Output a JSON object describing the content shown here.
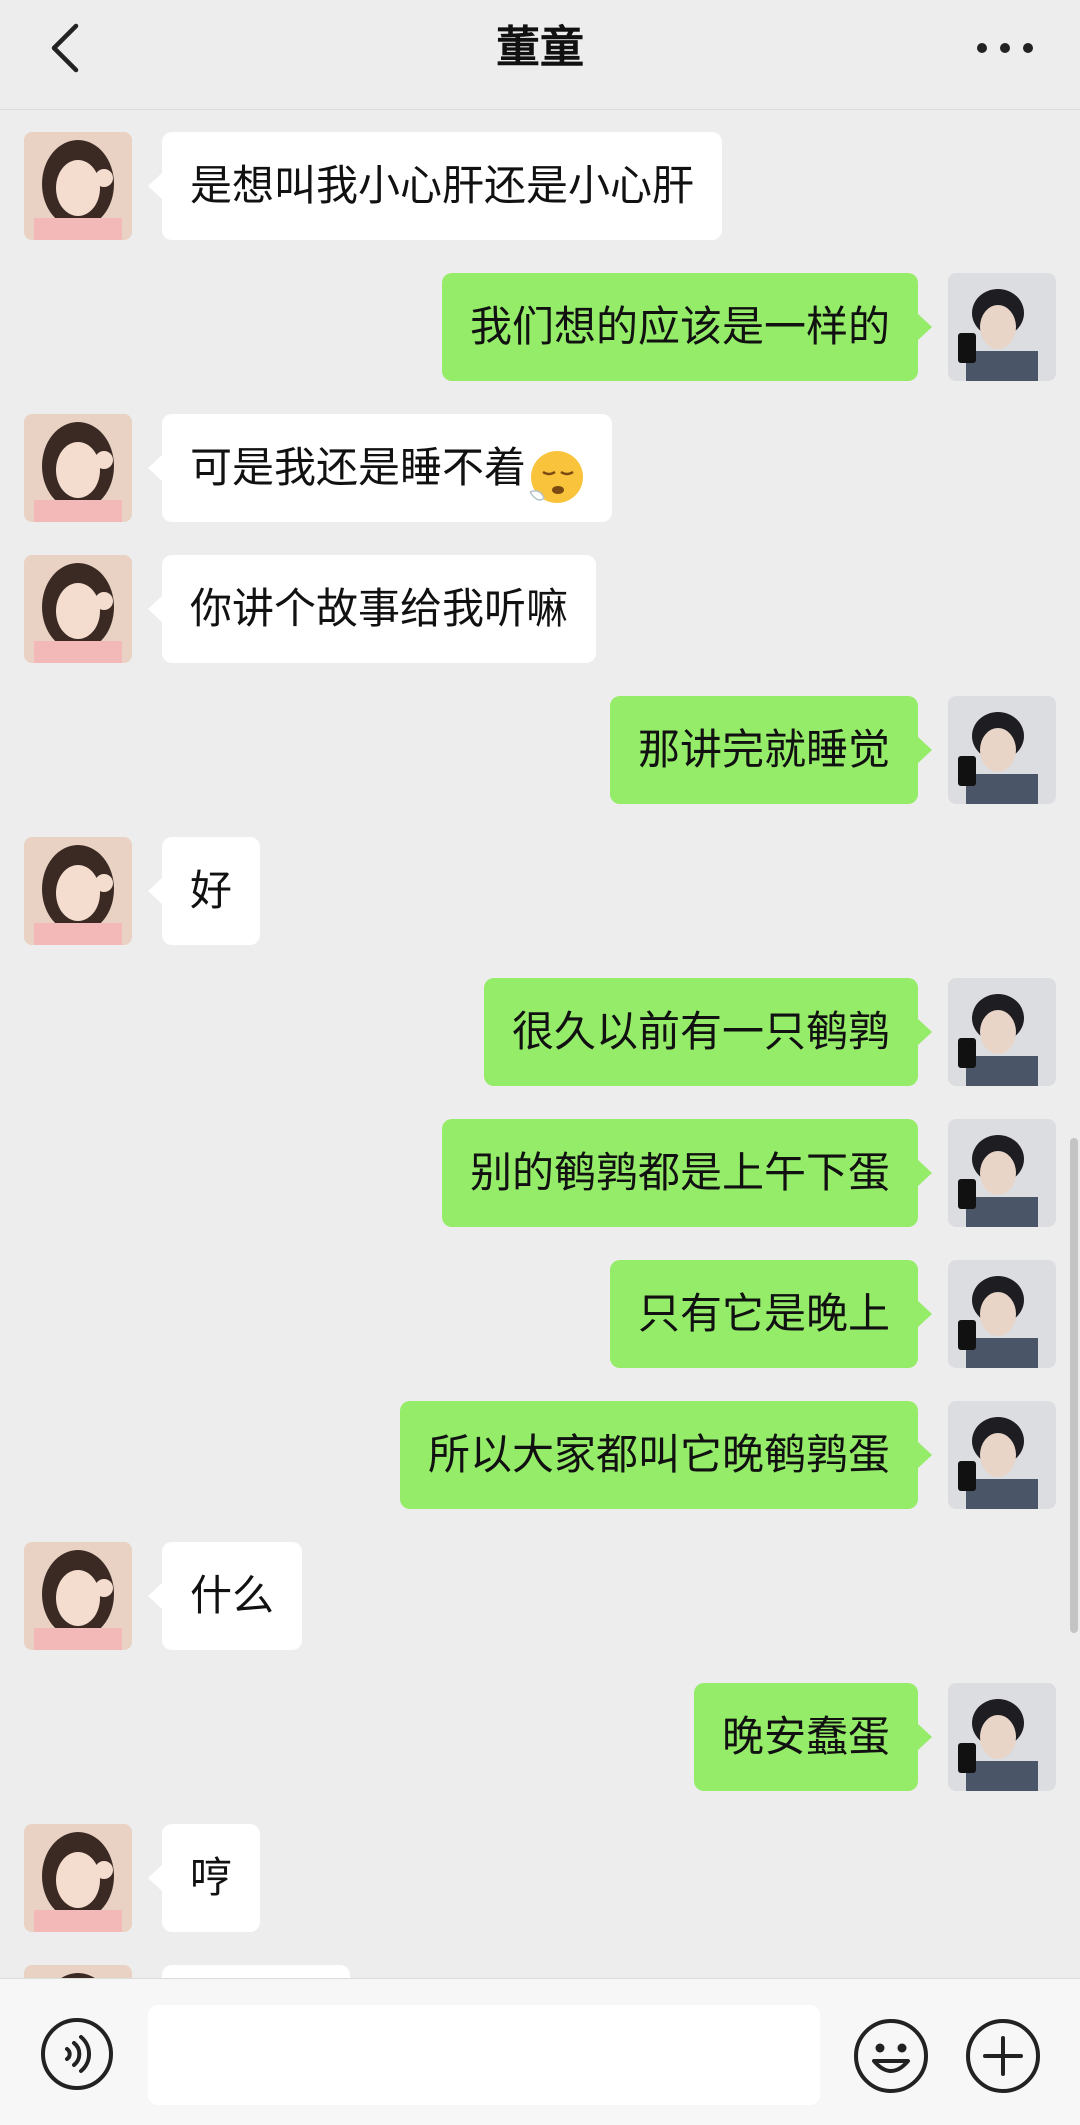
{
  "header": {
    "title": "董童",
    "back_icon": "chevron-left-icon",
    "more_icon": "more-dots-icon"
  },
  "messages": [
    {
      "side": "in",
      "text": "是想叫我小心肝还是小心肝"
    },
    {
      "side": "out",
      "text": "我们想的应该是一样的"
    },
    {
      "side": "in",
      "text": "可是我还是睡不着",
      "emoji": "sleepy-face-emoji"
    },
    {
      "side": "in",
      "text": "你讲个故事给我听嘛"
    },
    {
      "side": "out",
      "text": "那讲完就睡觉"
    },
    {
      "side": "in",
      "text": "好"
    },
    {
      "side": "out",
      "text": "很久以前有一只鹌鹑"
    },
    {
      "side": "out",
      "text": "别的鹌鹑都是上午下蛋"
    },
    {
      "side": "out",
      "text": "只有它是晚上"
    },
    {
      "side": "out",
      "text": "所以大家都叫它晚鹌鹑蛋"
    },
    {
      "side": "in",
      "text": "什么"
    },
    {
      "side": "out",
      "text": "晚安蠢蛋"
    },
    {
      "side": "in",
      "text": "哼"
    }
  ],
  "input_bar": {
    "value": "",
    "voice_icon": "voice-icon",
    "emoji_icon": "smiley-icon",
    "plus_icon": "plus-icon"
  },
  "colors": {
    "background": "#ededed",
    "incoming_bubble": "#ffffff",
    "outgoing_bubble": "#95ec69"
  }
}
